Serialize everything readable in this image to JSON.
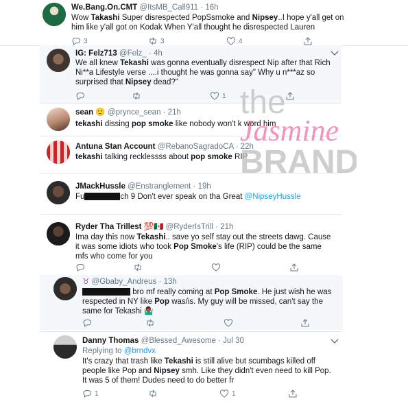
{
  "tweets": [
    {
      "name": "We.Bang.On.CMT",
      "handle": "@ItsMB_Call911",
      "time": "16h",
      "parts": [
        "Wow ",
        "Takashi",
        " Super disrespected PopSsmoke and ",
        "Nipsey",
        "..I hope y'all get on him like y'all got on Kodak When Y'all thought he disrespected Lauren"
      ],
      "replies": "3",
      "retweets": "3",
      "likes": "4"
    },
    {
      "name": "IG: Felz713",
      "handle": "@Felz_",
      "time": "4h",
      "parts": [
        "We all knew ",
        "Tekashi",
        " was gonna eventually disrespect Nip after that Rich Ni**a Lifestyle verse ....i thought he was gonna say\" Why u n***az so surprised that ",
        "Nipsey",
        " dead?\""
      ],
      "replies": "",
      "retweets": "",
      "likes": "1"
    },
    {
      "name": "sean",
      "emoji": "🙂",
      "handle": "@prynce_sean",
      "time": "21h",
      "parts": [
        "tekashi",
        " dissing ",
        "pop smoke",
        " like nobody won't k word him"
      ]
    },
    {
      "name": "Antuna Stan Account",
      "handle": "@RebanoSagradoCA",
      "time": "22h",
      "parts": [
        "tekashi",
        " talking recklessss about ",
        "pop smoke",
        " RIP"
      ]
    },
    {
      "name": "JMackHussle",
      "handle": "@Enstranglement",
      "time": "19h",
      "prefix": "Fu",
      "rest": "ch 9 Don't ever speak on tha Great ",
      "mention": "@NipseyHussle"
    },
    {
      "name": "Ryder Tha Trillest",
      "emoji": "💯🇲🇽",
      "handle": "@RyderIsTrill",
      "time": "21h",
      "parts": [
        "Ima day this now ",
        "Tekashi",
        ".. save yo self stay out the streets dawg. Cause it was some idiots who took ",
        "Pop Smoke",
        "'s life (RIP) could be the same mfs who come for you"
      ]
    },
    {
      "name": "",
      "emoji": "♉",
      "handle": "@Gbaby_Andreus",
      "time": "13h",
      "parts": [
        " bro mf really coming at ",
        "Pop Smoke",
        ". He just wish he was respected in NY like ",
        "Pop",
        " was/is. My guy will be missed, can't say the same for Tekashi 🤷🏾‍♂️"
      ]
    },
    {
      "name": "Danny Thomas",
      "handle": "@Blessed_Awesome",
      "time": "Jul 30",
      "replying_label": "Replying to ",
      "replying_to": "@brndvx",
      "parts": [
        "It's crazy that trash like ",
        "Tekashi",
        " is still alive but scumbags killed off people like Pop and ",
        "Nipsey",
        " smh. Like they didn't even need to kill Pop. It was 5 of them! Dudes need to do better fr"
      ],
      "replies": "1",
      "retweets": "",
      "likes": "1"
    }
  ],
  "watermark": {
    "line1": "the",
    "line2": "Jasmine",
    "line3": "BRAND"
  },
  "colors": {
    "link": "#1da1f2",
    "handle": "#657786",
    "separator": "#e1e8ed",
    "watermark": "#bdbdbd",
    "watermark_pink": "#e73d84"
  }
}
